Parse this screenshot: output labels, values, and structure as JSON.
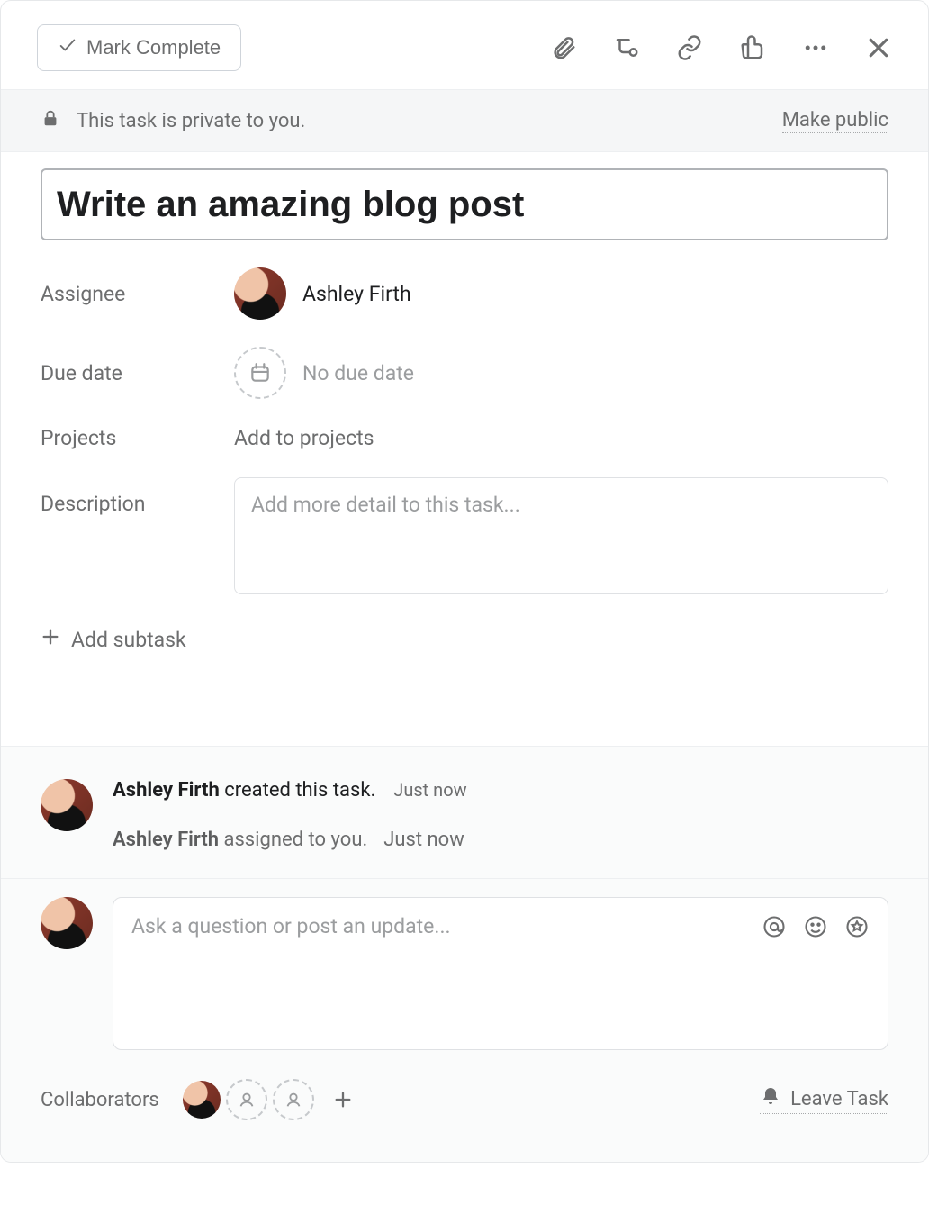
{
  "toolbar": {
    "mark_complete_label": "Mark Complete",
    "icons": {
      "attachment": "attachment-icon",
      "subtask": "subtask-icon",
      "link": "link-icon",
      "like": "like-icon",
      "more": "more-icon",
      "close": "close-icon"
    }
  },
  "privacy": {
    "text": "This task is private to you.",
    "make_public_label": "Make public"
  },
  "task": {
    "title": "Write an amazing blog post",
    "assignee_label": "Assignee",
    "assignee_name": "Ashley Firth",
    "due_date_label": "Due date",
    "due_date_value": "No due date",
    "projects_label": "Projects",
    "projects_value": "Add to projects",
    "description_label": "Description",
    "description_placeholder": "Add more detail to this task...",
    "add_subtask_label": "Add subtask"
  },
  "activity": {
    "creator_name": "Ashley Firth",
    "created_suffix": " created this task.",
    "created_ts": "Just now",
    "assigned_name": "Ashley Firth",
    "assigned_suffix": " assigned to you.",
    "assigned_ts": "Just now"
  },
  "comment": {
    "placeholder": "Ask a question or post an update..."
  },
  "footer": {
    "collaborators_label": "Collaborators",
    "leave_task_label": "Leave Task"
  }
}
